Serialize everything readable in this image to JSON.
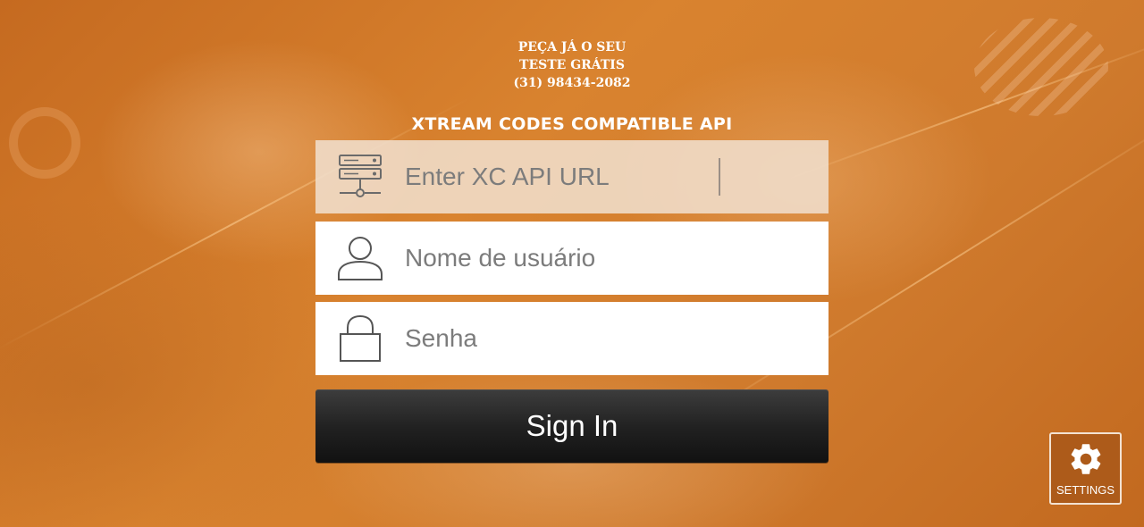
{
  "promo": {
    "line1": "PEÇA JÁ O SEU",
    "line2": "TESTE GRÁTIS",
    "line3": "(31) 98434-2082"
  },
  "title": "XTREAM CODES COMPATIBLE API",
  "fields": {
    "url": {
      "placeholder": "Enter XC API URL",
      "value": "",
      "icon": "server-icon"
    },
    "username": {
      "placeholder": "Nome de usuário",
      "value": "",
      "icon": "user-icon"
    },
    "password": {
      "placeholder": "Senha",
      "value": "",
      "icon": "lock-icon"
    }
  },
  "sign_in_label": "Sign In",
  "settings": {
    "label": "SETTINGS",
    "icon": "gear-icon"
  },
  "colors": {
    "background": "#d27a2c",
    "button": "#222222",
    "active_field": "#f0decc"
  }
}
